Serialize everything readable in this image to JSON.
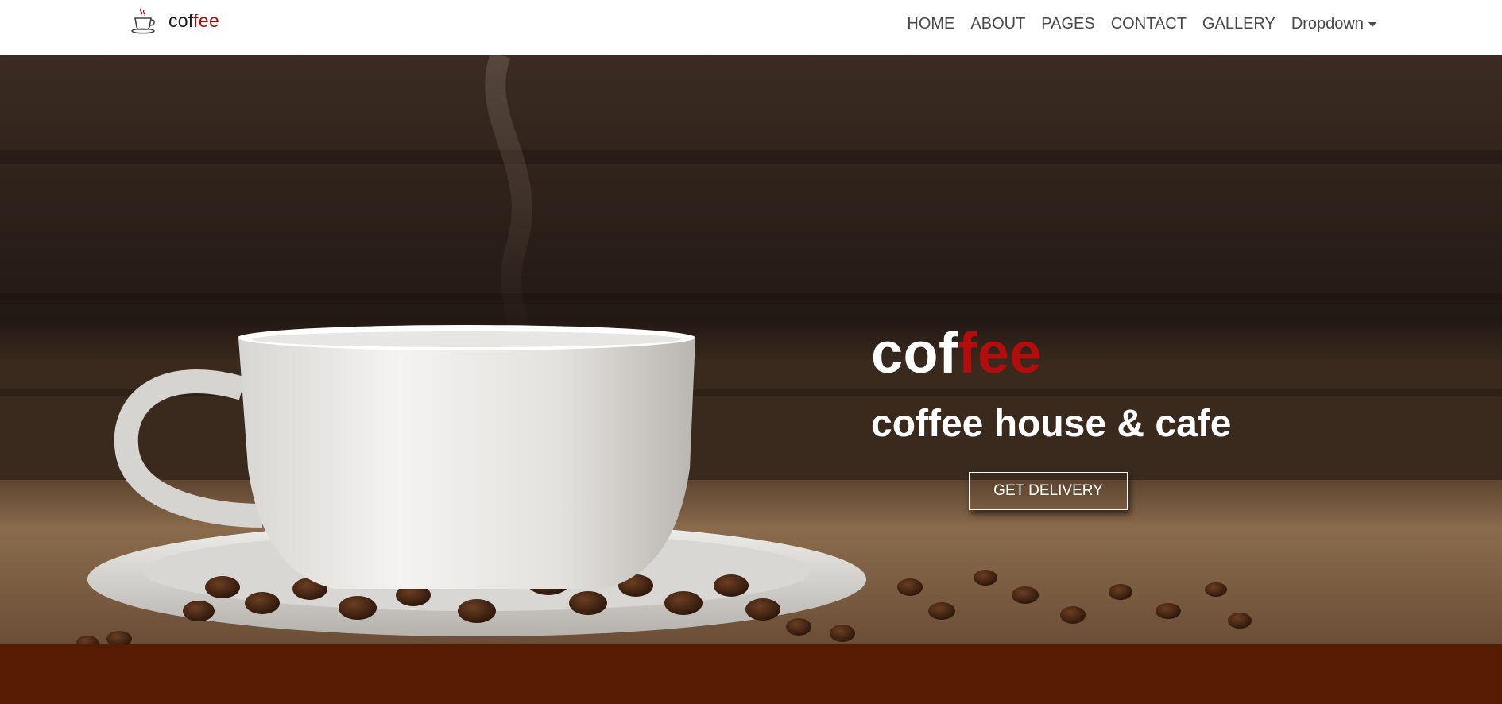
{
  "brand": {
    "text_dark": "cof",
    "text_red": "fee",
    "icon": "coffee-cup-icon"
  },
  "nav": {
    "items": [
      "HOME",
      "ABOUT",
      "PAGES",
      "CONTACT",
      "GALLERY"
    ],
    "dropdown_label": "Dropdown"
  },
  "hero": {
    "title_white": "cof",
    "title_red": "fee",
    "subtitle": "coffee house & cafe",
    "cta_label": "GET DELIVERY"
  },
  "colors": {
    "accent_red": "#b30d0d",
    "footer_band": "#561b03",
    "nav_text": "#4a4a4a"
  }
}
